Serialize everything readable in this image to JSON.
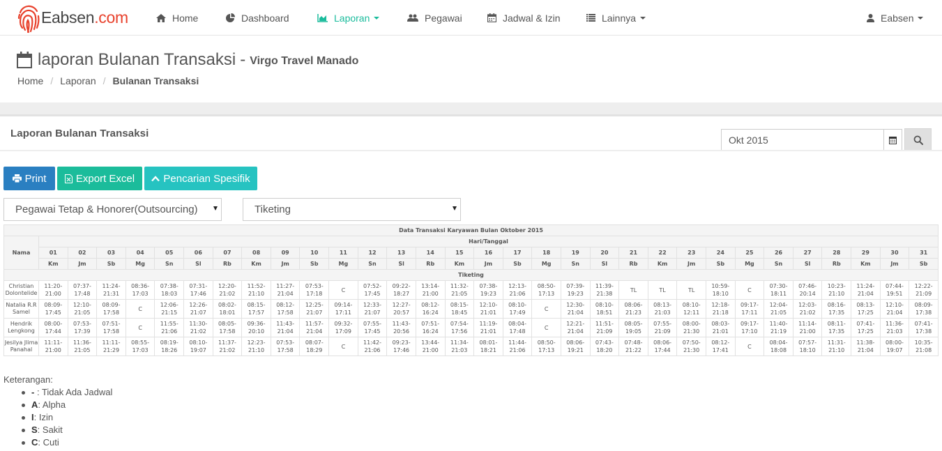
{
  "brand": {
    "name": "Eabsen",
    "domain": ".com"
  },
  "nav": {
    "home": "Home",
    "dashboard": "Dashboard",
    "laporan": "Laporan",
    "pegawai": "Pegawai",
    "jadwal": "Jadwal & Izin",
    "lainnya": "Lainnya",
    "user": "Eabsen"
  },
  "colors": {
    "accent": "#1abc9c",
    "print": "#2a7fc1",
    "excel": "#1bbc9b",
    "search": "#26c3c1",
    "logo": "#e8412c"
  },
  "header": {
    "title": "laporan Bulanan Transaksi",
    "dash": "-",
    "company": "Virgo Travel Manado",
    "breadcrumb": [
      "Home",
      "Laporan",
      "Bulanan Transaksi"
    ]
  },
  "panel": {
    "title": "Laporan Bulanan Transaksi",
    "month_value": "Okt 2015"
  },
  "buttons": {
    "print": "Print",
    "excel": "Export Excel",
    "search": "Pencarian Spesifik"
  },
  "filters": {
    "employee_type": "Pegawai Tetap & Honorer(Outsourcing)",
    "division": "Tiketing"
  },
  "table": {
    "title": "Data Transaksi Karyawan Bulan Oktober 2015",
    "day_header": "Hari/Tanggal",
    "name_header": "Nama",
    "group": "Tiketing",
    "dates": [
      "01",
      "02",
      "03",
      "04",
      "05",
      "06",
      "07",
      "08",
      "09",
      "10",
      "11",
      "12",
      "13",
      "14",
      "15",
      "16",
      "17",
      "18",
      "19",
      "20",
      "21",
      "22",
      "23",
      "24",
      "25",
      "26",
      "27",
      "28",
      "29",
      "30",
      "31"
    ],
    "days": [
      "Km",
      "Jm",
      "Sb",
      "Mg",
      "Sn",
      "Sl",
      "Rb",
      "Km",
      "Jm",
      "Sb",
      "Mg",
      "Sn",
      "Sl",
      "Rb",
      "Km",
      "Jm",
      "Sb",
      "Mg",
      "Sn",
      "Sl",
      "Rb",
      "Km",
      "Jm",
      "Sb",
      "Mg",
      "Sn",
      "Sl",
      "Rb",
      "Km",
      "Jm",
      "Sb"
    ],
    "rows": [
      {
        "name": "Christian Dolontelide",
        "cells": [
          "11:20-21:00",
          "07:37-17:48",
          "11:24-21:31",
          "08:36-17:03",
          "07:38-18:03",
          "07:31-17:46",
          "12:20-21:02",
          "11:52-21:10",
          "11:27-21:04",
          "07:53-17:18",
          "C",
          "07:52-17:45",
          "09:22-18:27",
          "13:14-21:00",
          "11:32-21:05",
          "07:38-19:23",
          "12:13-21:06",
          "08:50-17:13",
          "07:39-19:23",
          "11:39-21:38",
          "TL",
          "TL",
          "TL",
          "10:59-18:10",
          "C",
          "07:30-18:11",
          "07:46-20:14",
          "10:23-21:10",
          "11:24-21:04",
          "07:44-19:51",
          "12:22-21:09"
        ]
      },
      {
        "name": "Natalia R.R Samel",
        "cells": [
          "08:09-17:45",
          "12:10-21:05",
          "08:09-17:58",
          "C",
          "12:06-21:15",
          "12:26-21:07",
          "08:02-18:01",
          "08:15-17:57",
          "08:12-17:58",
          "12:25-21:07",
          "09:14-17:11",
          "12:33-21:07",
          "12:27-20:57",
          "08:12-16:24",
          "08:15-18:45",
          "12:10-21:01",
          "08:10-17:49",
          "C",
          "12:30-21:04",
          "08:10-18:51",
          "08:06-21:23",
          "08:13-21:03",
          "08:10-12:11",
          "12:18-21:18",
          "09:17-17:11",
          "12:04-21:05",
          "12:03-21:02",
          "08:16-17:35",
          "08:13-17:25",
          "12:10-21:04",
          "08:09-17:38"
        ]
      },
      {
        "name": "Hendrik Lengkong",
        "cells": [
          "08:00-17:44",
          "07:53-17:39",
          "07:51-17:58",
          "C",
          "11:55-21:06",
          "11:30-21:02",
          "08:05-17:58",
          "09:36-20:10",
          "11:43-21:04",
          "11:57-21:04",
          "09:32-17:09",
          "07:55-17:45",
          "11:43-20:56",
          "07:51-16:24",
          "07:54-17:56",
          "11:19-21:01",
          "08:04-17:48",
          "C",
          "12:21-21:04",
          "11:51-21:09",
          "08:05-19:05",
          "07:55-21:09",
          "08:00-21:30",
          "08:03-21:01",
          "09:17-17:10",
          "11:40-21:19",
          "11:14-21:00",
          "08:11-17:35",
          "07:41-17:25",
          "11:36-21:03",
          "07:41-17:38"
        ]
      },
      {
        "name": "Jesilya Jlima Panahal",
        "cells": [
          "11:11-21:00",
          "11:36-21:05",
          "11:11-21:29",
          "08:55-17:03",
          "08:19-18:26",
          "08:10-19:07",
          "11:37-21:02",
          "12:23-21:10",
          "07:53-17:58",
          "08:07-18:29",
          "C",
          "11:42-21:06",
          "09:23-17:46",
          "13:44-21:00",
          "11:34-21:03",
          "08:01-18:21",
          "11:44-21:06",
          "08:50-17:13",
          "08:06-19:21",
          "07:43-18:20",
          "07:48-21:22",
          "08:06-17:44",
          "07:50-21:30",
          "08:12-17:41",
          "C",
          "08:04-18:08",
          "07:57-18:10",
          "11:31-21:10",
          "11:38-21:04",
          "08:00-19:07",
          "10:35-21:08"
        ]
      }
    ]
  },
  "legend": {
    "title": "Keterangan:",
    "items": [
      {
        "key": "-",
        "desc": " : Tidak Ada Jadwal"
      },
      {
        "key": "A",
        "desc": ": Alpha"
      },
      {
        "key": "I",
        "desc": ": Izin"
      },
      {
        "key": "S",
        "desc": ": Sakit"
      },
      {
        "key": "C",
        "desc": ": Cuti"
      }
    ]
  }
}
